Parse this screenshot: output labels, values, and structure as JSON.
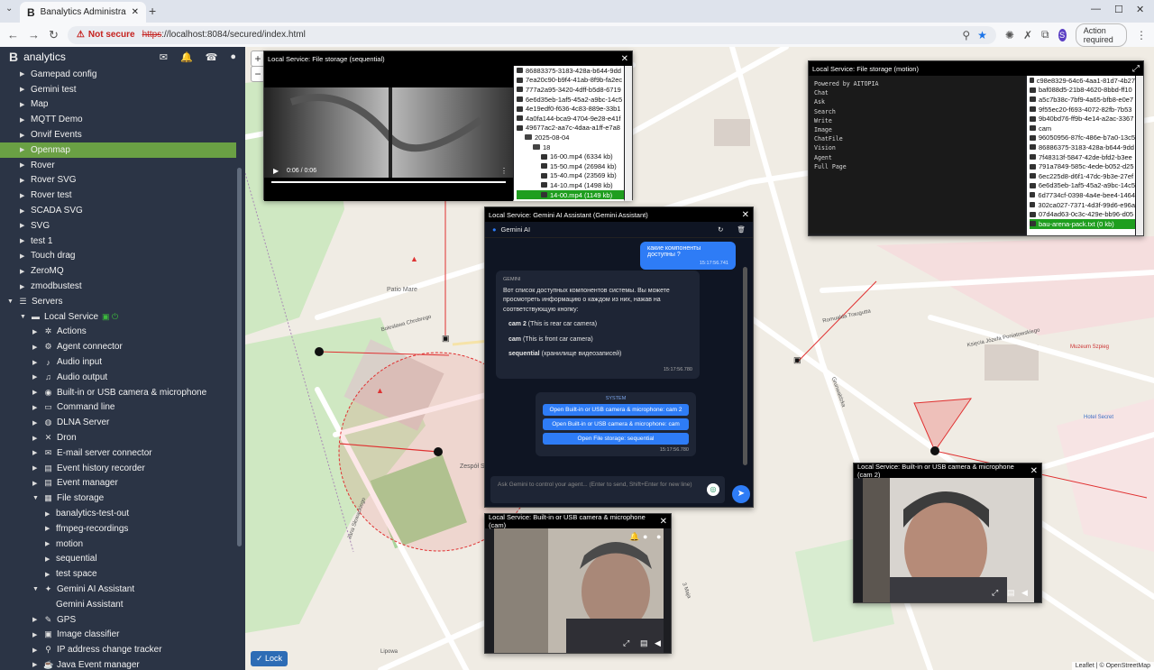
{
  "browser": {
    "tab_title": "Banalytics Administration Cons",
    "tab_logo": "B",
    "new_tab": "+",
    "security": "Not secure",
    "url_scheme": "https",
    "url_rest": "://localhost:8084/secured/index.html",
    "action_required": "Action required",
    "profile": "S"
  },
  "sidebar": {
    "brand": "analytics",
    "brand_logo": "B",
    "items": [
      {
        "label": "Gamepad config",
        "depth": 1,
        "caret": "▶"
      },
      {
        "label": "Gemini test",
        "depth": 1,
        "caret": "▶"
      },
      {
        "label": "Map",
        "depth": 1,
        "caret": "▶"
      },
      {
        "label": "MQTT Demo",
        "depth": 1,
        "caret": "▶"
      },
      {
        "label": "Onvif Events",
        "depth": 1,
        "caret": "▶"
      },
      {
        "label": "Openmap",
        "depth": 1,
        "caret": "▶",
        "active": true
      },
      {
        "label": "Rover",
        "depth": 1,
        "caret": "▶"
      },
      {
        "label": "Rover SVG",
        "depth": 1,
        "caret": "▶"
      },
      {
        "label": "Rover test",
        "depth": 1,
        "caret": "▶"
      },
      {
        "label": "SCADA SVG",
        "depth": 1,
        "caret": "▶"
      },
      {
        "label": "SVG",
        "depth": 1,
        "caret": "▶"
      },
      {
        "label": "test 1",
        "depth": 1,
        "caret": "▶"
      },
      {
        "label": "Touch drag",
        "depth": 1,
        "caret": "▶"
      },
      {
        "label": "ZeroMQ",
        "depth": 1,
        "caret": "▶"
      },
      {
        "label": "zmodbustest",
        "depth": 1,
        "caret": "▶"
      },
      {
        "label": "Servers",
        "depth": 0,
        "caret": "▼",
        "glyph": "☰"
      },
      {
        "label": "Local Service",
        "depth": 1,
        "caret": "▼",
        "glyph": "▬",
        "online": true
      },
      {
        "label": "Actions",
        "depth": 2,
        "caret": "▶",
        "glyph": "✲"
      },
      {
        "label": "Agent connector",
        "depth": 2,
        "caret": "▶",
        "glyph": "⚙"
      },
      {
        "label": "Audio input",
        "depth": 2,
        "caret": "▶",
        "glyph": "♪"
      },
      {
        "label": "Audio output",
        "depth": 2,
        "caret": "▶",
        "glyph": "♫"
      },
      {
        "label": "Built-in or USB camera & microphone",
        "depth": 2,
        "caret": "▶",
        "glyph": "◉"
      },
      {
        "label": "Command line",
        "depth": 2,
        "caret": "▶",
        "glyph": "▭"
      },
      {
        "label": "DLNA Server",
        "depth": 2,
        "caret": "▶",
        "glyph": "◍"
      },
      {
        "label": "Dron",
        "depth": 2,
        "caret": "▶",
        "glyph": "✕"
      },
      {
        "label": "E-mail server connector",
        "depth": 2,
        "caret": "▶",
        "glyph": "✉"
      },
      {
        "label": "Event history recorder",
        "depth": 2,
        "caret": "▶",
        "glyph": "▤"
      },
      {
        "label": "Event manager",
        "depth": 2,
        "caret": "▶",
        "glyph": "▤"
      },
      {
        "label": "File storage",
        "depth": 2,
        "caret": "▼",
        "glyph": "▦"
      },
      {
        "label": "banalytics-test-out",
        "depth": 3,
        "caret": "▶"
      },
      {
        "label": "ffmpeg-recordings",
        "depth": 3,
        "caret": "▶"
      },
      {
        "label": "motion",
        "depth": 3,
        "caret": "▶"
      },
      {
        "label": "sequential",
        "depth": 3,
        "caret": "▶"
      },
      {
        "label": "test space",
        "depth": 3,
        "caret": "▶"
      },
      {
        "label": "Gemini AI Assistant",
        "depth": 2,
        "caret": "▼",
        "glyph": "✦"
      },
      {
        "label": "Gemini Assistant",
        "depth": 3,
        "caret": ""
      },
      {
        "label": "GPS",
        "depth": 2,
        "caret": "▶",
        "glyph": "✎"
      },
      {
        "label": "Image classifier",
        "depth": 2,
        "caret": "▶",
        "glyph": "▣"
      },
      {
        "label": "IP address change tracker",
        "depth": 2,
        "caret": "▶",
        "glyph": "⚲"
      },
      {
        "label": "Java Event manager",
        "depth": 2,
        "caret": "▶",
        "glyph": "☕"
      }
    ]
  },
  "map": {
    "lock_label": "✓ Lock",
    "attribution": "Leaflet | © OpenStreetMap",
    "zoom_in": "+",
    "zoom_out": "−",
    "labels": [
      {
        "text": "Patio Mare"
      },
      {
        "text": "Bolesława Chrobrego"
      },
      {
        "text": "Zespół Szkół nr"
      },
      {
        "text": "Romualda Traugutta"
      },
      {
        "text": "Grunwaldzka"
      },
      {
        "text": "Księcia Józefa Poniatowskiego"
      },
      {
        "text": "Jana Słowackiego"
      },
      {
        "text": "Muzeum Szpieg"
      },
      {
        "text": "Hotel Secret"
      },
      {
        "text": "Lipowa"
      },
      {
        "text": "3 Maja"
      }
    ]
  },
  "windows": {
    "sequential": {
      "title": "Local Service: File storage (sequential)",
      "time": "0:06 / 0:06",
      "files": [
        {
          "name": "86883375-3183-428a-b644-9dd",
          "type": "file"
        },
        {
          "name": "7ea20c90-b9f4-41ab-8f9b-fa2ec",
          "type": "file"
        },
        {
          "name": "777a2a95-3420-4dff-b5d8-6719",
          "type": "file"
        },
        {
          "name": "6e6d35eb-1af5-45a2-a9bc-14c5",
          "type": "file"
        },
        {
          "name": "4e19edf0-f636-4c83-889e-33b1",
          "type": "file"
        },
        {
          "name": "4a0fa144-bca9-4704-9e28-e41f",
          "type": "file"
        },
        {
          "name": "49677ac2-aa7c-4daa-a1ff-e7a8",
          "type": "file"
        },
        {
          "name": "2025-08-04",
          "type": "folder",
          "indent": 1
        },
        {
          "name": "18",
          "type": "folder",
          "indent": 2
        },
        {
          "name": "16-00.mp4 (6334 kb)",
          "type": "file",
          "indent": 3
        },
        {
          "name": "15-50.mp4 (26984 kb)",
          "type": "file",
          "indent": 3
        },
        {
          "name": "15-40.mp4 (23569 kb)",
          "type": "file",
          "indent": 3
        },
        {
          "name": "14-10.mp4 (1498 kb)",
          "type": "file",
          "indent": 3
        },
        {
          "name": "14-00.mp4 (1149 kb)",
          "type": "file",
          "indent": 3,
          "selected": true
        }
      ]
    },
    "motion": {
      "title": "Local Service: File storage (motion)",
      "terminal": [
        "Powered by AITOPIA",
        "Chat",
        "Ask",
        "Search",
        "Write",
        "Image",
        "ChatFile",
        "Vision",
        "Agent",
        "Full Page"
      ],
      "files": [
        {
          "name": "c98e8329-64c6-4aa1-81d7-4b27",
          "type": "file"
        },
        {
          "name": "baf088d5-21b8-4620-8bbd-ff10",
          "type": "file"
        },
        {
          "name": "a5c7b38c-7bf9-4a65-bfb8-e0e7",
          "type": "file"
        },
        {
          "name": "9f55ec20-f693-4072-82fb-7b53",
          "type": "file"
        },
        {
          "name": "9b40bd76-ff9b-4e14-a2ac-3367",
          "type": "file"
        },
        {
          "name": "cam",
          "type": "file"
        },
        {
          "name": "96050956-87fc-486e-b7a0-13c5",
          "type": "file"
        },
        {
          "name": "86886375-3183-428a-b644-9dd",
          "type": "file"
        },
        {
          "name": "7f48313f-5847-42de-bfd2-b3ee",
          "type": "file"
        },
        {
          "name": "791a7849-585c-4ede-b052-d25",
          "type": "file"
        },
        {
          "name": "6ec225d8-d6f1-47dc-9b3e-27ef",
          "type": "file"
        },
        {
          "name": "6e6d35eb-1af5-45a2-a9bc-14c5",
          "type": "file"
        },
        {
          "name": "6d7734cf-0398-4a4e-bee4-1464",
          "type": "file"
        },
        {
          "name": "302ca027-7371-4d3f-99d6-e96a",
          "type": "file"
        },
        {
          "name": "07d4ad63-0c3c-429e-bb96-d05",
          "type": "file"
        },
        {
          "name": "bau-arena-pack.txt (0 kb)",
          "type": "file",
          "selected": true
        }
      ]
    },
    "gemini": {
      "title": "Local Service: Gemini AI Assistant (Gemini Assistant)",
      "header": "Gemini AI",
      "user_msg": "какие компоненты доступны ?",
      "user_time": "15:17:56.741",
      "ai_tag": "GEMINI",
      "ai_intro": "Вот список доступных компонентов системы. Вы можете просмотреть информацию о каждом из них, нажав на соответствующую кнопку:",
      "ai_items": [
        {
          "bold": "cam 2",
          "rest": " (This is rear car camera)"
        },
        {
          "bold": "cam",
          "rest": " (This is front car camera)"
        },
        {
          "bold": "sequential",
          "rest": " (хранилище видеозаписей)"
        }
      ],
      "ai_time": "15:17:56.780",
      "sys_tag": "SYSTEM",
      "sys_buttons": [
        "Open Built-in or USB camera & microphone: cam 2",
        "Open Built-in or USB camera & microphone: cam",
        "Open File storage: sequential"
      ],
      "sys_time": "15:17:56.780",
      "input_placeholder": "Ask Gemini to control your agent... (Enter to send, Shift+Enter for new line)"
    },
    "cam": {
      "title": "Local Service: Built-in or USB camera & microphone (cam)"
    },
    "cam2": {
      "title": "Local Service: Built-in or USB camera & microphone (cam 2)"
    }
  },
  "colors": {
    "sidebar_bg": "#2b3445",
    "active": "#6aa044",
    "accent": "#2e7cf6",
    "selected_file": "#1f9e1f"
  }
}
